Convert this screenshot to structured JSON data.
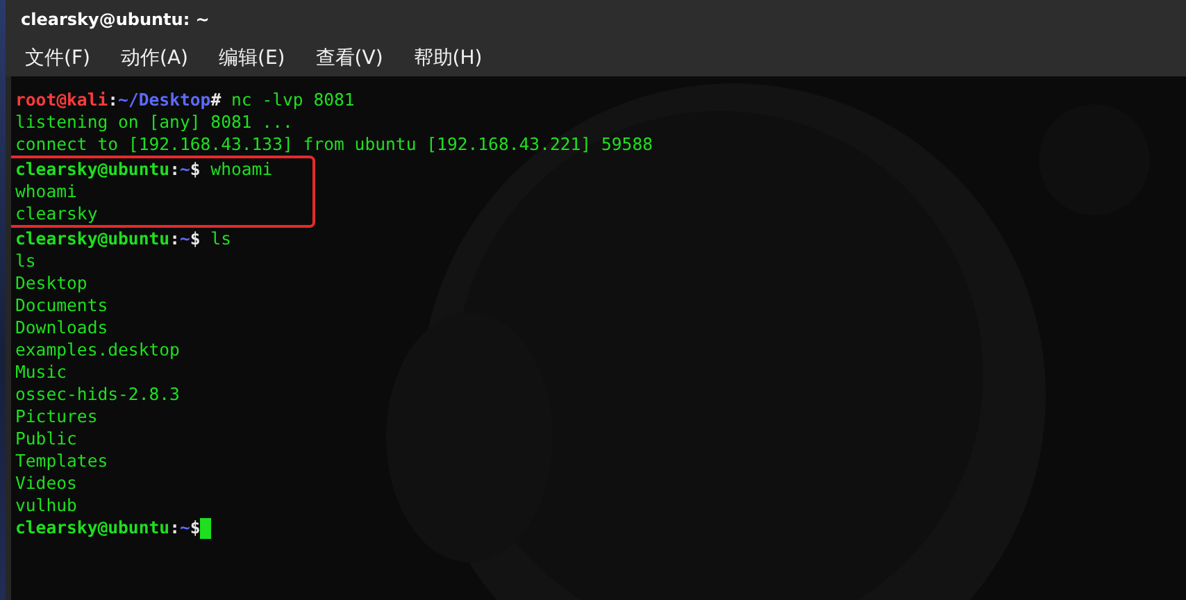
{
  "window": {
    "title": "clearsky@ubuntu: ~"
  },
  "menu": [
    {
      "label": "文件(F)"
    },
    {
      "label": "动作(A)"
    },
    {
      "label": "编辑(E)"
    },
    {
      "label": "查看(V)"
    },
    {
      "label": "帮助(H)"
    }
  ],
  "terminal": {
    "lines": [
      {
        "kind": "prompt",
        "user": "root@kali",
        "color": "#ff3b3b",
        "sep": ":",
        "path": "~/Desktop",
        "symbol": "#",
        "command": " nc -lvp 8081",
        "highlighted": false,
        "cursor": false
      },
      {
        "kind": "output",
        "text": "listening on [any] 8081 ...",
        "highlighted": false
      },
      {
        "kind": "output",
        "text": "connect to [192.168.43.133] from ubuntu [192.168.43.221] 59588",
        "highlighted": false
      },
      {
        "kind": "prompt",
        "user": "clearsky@ubuntu",
        "color": "#1ee01e",
        "sep": ":",
        "path": "~",
        "symbol": "$",
        "command": " whoami",
        "highlighted": true,
        "cursor": false
      },
      {
        "kind": "output",
        "text": "whoami",
        "highlighted": true
      },
      {
        "kind": "output",
        "text": "clearsky",
        "highlighted": true
      },
      {
        "kind": "prompt",
        "user": "clearsky@ubuntu",
        "color": "#1ee01e",
        "sep": ":",
        "path": "~",
        "symbol": "$",
        "command": " ls",
        "highlighted": false,
        "cursor": false
      },
      {
        "kind": "output",
        "text": "ls",
        "highlighted": false
      },
      {
        "kind": "output",
        "text": "Desktop",
        "highlighted": false
      },
      {
        "kind": "output",
        "text": "Documents",
        "highlighted": false
      },
      {
        "kind": "output",
        "text": "Downloads",
        "highlighted": false
      },
      {
        "kind": "output",
        "text": "examples.desktop",
        "highlighted": false
      },
      {
        "kind": "output",
        "text": "Music",
        "highlighted": false
      },
      {
        "kind": "output",
        "text": "ossec-hids-2.8.3",
        "highlighted": false
      },
      {
        "kind": "output",
        "text": "Pictures",
        "highlighted": false
      },
      {
        "kind": "output",
        "text": "Public",
        "highlighted": false
      },
      {
        "kind": "output",
        "text": "Templates",
        "highlighted": false
      },
      {
        "kind": "output",
        "text": "Videos",
        "highlighted": false
      },
      {
        "kind": "output",
        "text": "vulhub",
        "highlighted": false
      },
      {
        "kind": "prompt",
        "user": "clearsky@ubuntu",
        "color": "#1ee01e",
        "sep": ":",
        "path": "~",
        "symbol": "$",
        "highlighted": false,
        "cursor": true
      }
    ]
  }
}
